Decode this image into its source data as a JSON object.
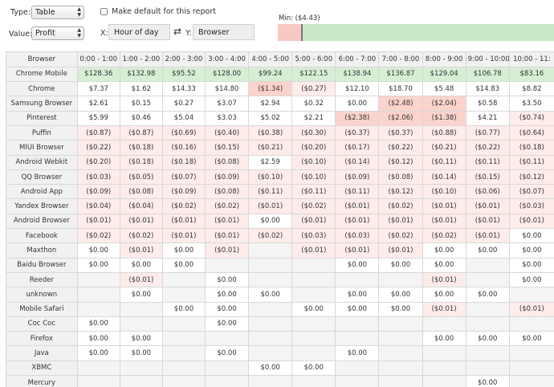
{
  "controls": {
    "type_label": "Type:",
    "type_value": "Table",
    "default_label": "Make default for this report",
    "value_label": "Value:",
    "value_value": "Profit",
    "x_label": "X:",
    "x_value": "Hour of day",
    "y_label": "Y:",
    "y_value": "Browser",
    "min_label": "Min: ($4.43)"
  },
  "table": {
    "corner": "Browser",
    "columns": [
      "0:00 - 1:00",
      "1:00 - 2:00",
      "2:00 - 3:00",
      "3:00 - 4:00",
      "4:00 - 5:00",
      "5:00 - 6:00",
      "6:00 - 7:00",
      "7:00 - 8:00",
      "8:00 - 9:00",
      "9:00 - 10:00",
      "10:00 - 11:"
    ],
    "rows": [
      {
        "name": "Chrome Mobile",
        "cells": [
          "$128.36",
          "$132.98",
          "$95.52",
          "$128.00",
          "$99.24",
          "$122.15",
          "$138.94",
          "$136.87",
          "$129.04",
          "$106.78",
          "$83.16"
        ]
      },
      {
        "name": "Chrome",
        "cells": [
          "$7.37",
          "$1.62",
          "$14.33",
          "$14.80",
          "($1.34)",
          "($0.27)",
          "$12.10",
          "$18.70",
          "$5.48",
          "$14.83",
          "$8.82"
        ]
      },
      {
        "name": "Samsung Browser",
        "cells": [
          "$2.61",
          "$0.15",
          "$0.27",
          "$3.07",
          "$2.94",
          "$0.32",
          "$0.00",
          "($2.48)",
          "($2.04)",
          "$0.58",
          "$3.50"
        ]
      },
      {
        "name": "Pinterest",
        "cells": [
          "$5.99",
          "$0.46",
          "$5.04",
          "$3.03",
          "$5.02",
          "$2.21",
          "($2.38)",
          "($2.06)",
          "($1.38)",
          "$4.21",
          "($0.74)"
        ]
      },
      {
        "name": "Puffin",
        "cells": [
          "($0.87)",
          "($0.87)",
          "($0.69)",
          "($0.40)",
          "($0.38)",
          "($0.30)",
          "($0.37)",
          "($0.37)",
          "($0.88)",
          "($0.77)",
          "($0.64)"
        ]
      },
      {
        "name": "MIUI Browser",
        "cells": [
          "($0.22)",
          "($0.18)",
          "($0.16)",
          "($0.15)",
          "($0.21)",
          "($0.20)",
          "($0.17)",
          "($0.22)",
          "($0.21)",
          "($0.22)",
          "($0.18)"
        ]
      },
      {
        "name": "Android Webkit",
        "cells": [
          "($0.20)",
          "($0.18)",
          "($0.18)",
          "($0.08)",
          "$2.59",
          "($0.10)",
          "($0.14)",
          "($0.12)",
          "($0.11)",
          "($0.11)",
          "($0.11)"
        ]
      },
      {
        "name": "QQ Browser",
        "cells": [
          "($0.03)",
          "($0.05)",
          "($0.07)",
          "($0.09)",
          "($0.10)",
          "($0.10)",
          "($0.09)",
          "($0.08)",
          "($0.14)",
          "($0.15)",
          "($0.12)"
        ]
      },
      {
        "name": "Android App",
        "cells": [
          "($0.09)",
          "($0.08)",
          "($0.09)",
          "($0.08)",
          "($0.11)",
          "($0.11)",
          "($0.11)",
          "($0.12)",
          "($0.10)",
          "($0.06)",
          "($0.07)"
        ]
      },
      {
        "name": "Yandex Browser",
        "cells": [
          "($0.04)",
          "($0.04)",
          "($0.02)",
          "($0.02)",
          "($0.01)",
          "($0.02)",
          "($0.01)",
          "($0.02)",
          "($0.01)",
          "($0.01)",
          "($0.03)"
        ]
      },
      {
        "name": "Android Browser",
        "cells": [
          "($0.01)",
          "($0.01)",
          "($0.01)",
          "($0.01)",
          "$0.00",
          "($0.01)",
          "($0.01)",
          "($0.01)",
          "($0.01)",
          "($0.01)",
          "($0.01)"
        ]
      },
      {
        "name": "Facebook",
        "cells": [
          "($0.02)",
          "($0.02)",
          "($0.01)",
          "($0.01)",
          "($0.02)",
          "($0.03)",
          "($0.03)",
          "($0.02)",
          "($0.02)",
          "($0.01)",
          "$0.00"
        ]
      },
      {
        "name": "Maxthon",
        "cells": [
          "$0.00",
          "($0.01)",
          "$0.00",
          "($0.01)",
          "",
          "($0.01)",
          "($0.01)",
          "($0.01)",
          "$0.00",
          "$0.00",
          "$0.00"
        ]
      },
      {
        "name": "Baidu Browser",
        "cells": [
          "$0.00",
          "$0.00",
          "$0.00",
          "",
          "",
          "",
          "$0.00",
          "$0.00",
          "$0.00",
          "",
          "$0.00"
        ]
      },
      {
        "name": "Reeder",
        "cells": [
          "",
          "($0.01)",
          "",
          "$0.00",
          "",
          "",
          "",
          "",
          "($0.01)",
          "",
          "$0.00"
        ]
      },
      {
        "name": "unknown",
        "cells": [
          "",
          "$0.00",
          "",
          "$0.00",
          "$0.00",
          "",
          "$0.00",
          "$0.00",
          "$0.00",
          "$0.00",
          ""
        ]
      },
      {
        "name": "Mobile Safari",
        "cells": [
          "",
          "",
          "$0.00",
          "$0.00",
          "",
          "$0.00",
          "$0.00",
          "$0.00",
          "($0.01)",
          "",
          "($0.01)"
        ]
      },
      {
        "name": "Coc Coc",
        "cells": [
          "$0.00",
          "",
          "",
          "$0.00",
          "",
          "",
          "",
          "",
          "",
          "",
          ""
        ]
      },
      {
        "name": "Firefox",
        "cells": [
          "$0.00",
          "$0.00",
          "",
          "",
          "",
          "",
          "",
          "",
          "$0.00",
          "$0.00",
          "$0.00"
        ]
      },
      {
        "name": "Java",
        "cells": [
          "$0.00",
          "$0.00",
          "",
          "$0.00",
          "",
          "",
          "$0.00",
          "",
          "",
          "",
          ""
        ]
      },
      {
        "name": "XBMC",
        "cells": [
          "",
          "",
          "",
          "",
          "$0.00",
          "$0.00",
          "",
          "",
          "",
          "",
          ""
        ]
      },
      {
        "name": "Mercury",
        "cells": [
          "",
          "",
          "",
          "",
          "",
          "",
          "",
          "",
          "",
          "$0.00",
          ""
        ]
      }
    ]
  }
}
